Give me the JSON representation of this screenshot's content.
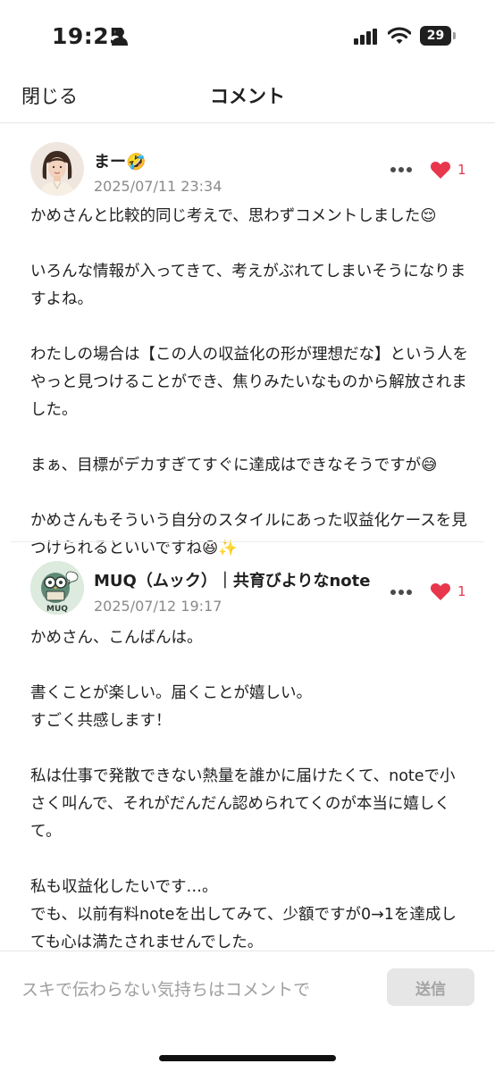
{
  "status_bar": {
    "time": "19:25",
    "battery": "29",
    "icons": [
      "person-icon",
      "signal-icon",
      "wifi-icon",
      "battery-icon"
    ]
  },
  "header": {
    "close_label": "閉じる",
    "title": "コメント"
  },
  "comments": [
    {
      "author": "まー🤣",
      "date": "2025/07/11 23:34",
      "likes": "1",
      "body": "かめさんと比較的同じ考えで、思わずコメントしました😌\n\nいろんな情報が入ってきて、考えがぶれてしまいそうになりますよね。\n\nわたしの場合は【この人の収益化の形が理想だな】という人をやっと見つけることができ、焦りみたいなものから解放されました。\n\nまぁ、目標がデカすぎてすぐに達成はできなそうですが😅\n\nかめさんもそういう自分のスタイルにあった収益化ケースを見つけられるといいですね😆✨"
    },
    {
      "author": "MUQ（ムック）｜共育びよりなnote",
      "avatar_text": "MUQ",
      "date": "2025/07/12 19:17",
      "likes": "1",
      "body": "かめさん、こんばんは。\n\n書くことが楽しい。届くことが嬉しい。\nすごく共感します！\n\n私は仕事で発散できない熱量を誰かに届けたくて、noteで小さく叫んで、それがだんだん認められてくのが本当に嬉しくて。\n\n私も収益化したいです…。\nでも、以前有料noteを出してみて、少額ですが0→1を達成しても心は満たされませんでした。\n\nもしかしたら、お金では無いのかも。\nそうしたモヤモヤとこれからも少しずつ戦っていきたいと思います！"
    }
  ],
  "footer": {
    "input_placeholder": "スキで伝わらない気持ちはコメントで",
    "send_label": "送信"
  },
  "colors": {
    "like": "#e8374d",
    "muted_text": "#8a8a8a",
    "send_disabled_bg": "#e6e6e6"
  }
}
